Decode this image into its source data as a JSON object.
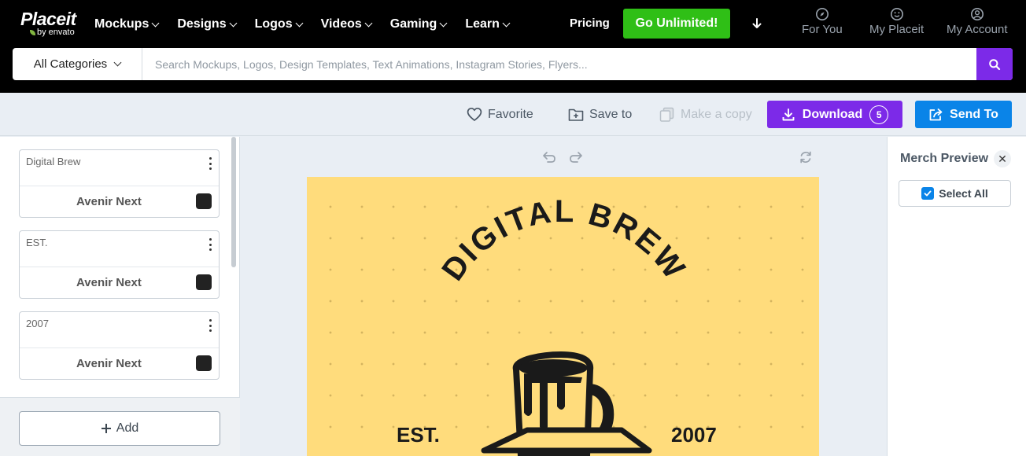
{
  "nav": {
    "logo_brand": "Placeit",
    "logo_sub": "by envato",
    "menu": [
      "Mockups",
      "Designs",
      "Logos",
      "Videos",
      "Gaming",
      "Learn"
    ],
    "pricing": "Pricing",
    "unlimited": "Go Unlimited!",
    "for_you": "For You",
    "my_placeit": "My Placeit",
    "my_account": "My Account"
  },
  "search": {
    "category": "All Categories",
    "placeholder": "Search Mockups, Logos, Design Templates, Text Animations, Instagram Stories, Flyers..."
  },
  "toolbar": {
    "favorite": "Favorite",
    "save_to": "Save to",
    "make_copy": "Make a copy",
    "download": "Download",
    "download_count": "5",
    "send_to": "Send To"
  },
  "text_layers": [
    {
      "title": "Digital Brew",
      "font": "Avenir Next",
      "color": "#222222"
    },
    {
      "title": "EST.",
      "font": "Avenir Next",
      "color": "#222222"
    },
    {
      "title": "2007",
      "font": "Avenir Next",
      "color": "#222222"
    }
  ],
  "add_label": "Add",
  "design": {
    "headline": "DIGITAL BREW",
    "est": "EST.",
    "year": "2007",
    "background": "#ffdc7c"
  },
  "merch": {
    "title": "Merch Preview",
    "close": "✕",
    "select_all": "Select All"
  },
  "colors": {
    "accent_purple": "#7c2ae8",
    "accent_blue": "#0a84e8",
    "accent_green": "#2fbf16"
  }
}
